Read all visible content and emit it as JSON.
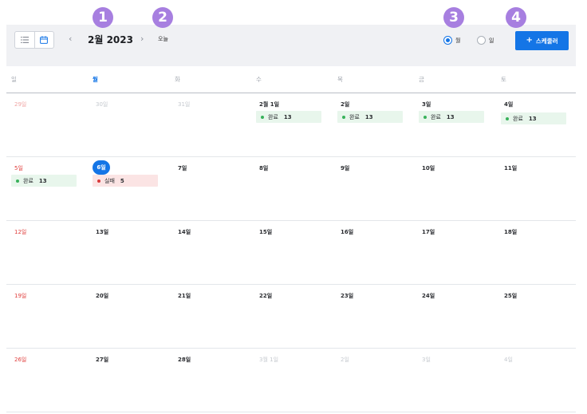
{
  "toolbar": {
    "month_title": "2월 2023",
    "prev_icon": "chevron-left-icon",
    "next_icon": "chevron-right-icon",
    "today_label": "오늘",
    "view_list_icon": "list-icon",
    "view_calendar_icon": "calendar-icon",
    "view_mode_month_label": "월",
    "view_mode_day_label": "일",
    "view_mode_selected": "월",
    "schedule_button_label": "스케줄러",
    "schedule_button_icon": "plus-icon",
    "accent_color": "#1475e6"
  },
  "callouts": [
    "1",
    "2",
    "3",
    "4"
  ],
  "weekdays": [
    "일",
    "월",
    "화",
    "수",
    "목",
    "금",
    "토"
  ],
  "weeks": [
    {
      "days": [
        {
          "label": "29일",
          "style": "muted-red"
        },
        {
          "label": "30일",
          "style": "muted"
        },
        {
          "label": "31일",
          "style": "muted"
        },
        {
          "label": "2월 1일",
          "style": "normal",
          "event": {
            "type": "done",
            "label": "완료",
            "count": "13"
          }
        },
        {
          "label": "2일",
          "style": "normal",
          "event": {
            "type": "done",
            "label": "완료",
            "count": "13"
          }
        },
        {
          "label": "3일",
          "style": "normal",
          "event": {
            "type": "done",
            "label": "완료",
            "count": "13"
          }
        },
        {
          "label": "4일",
          "style": "normal",
          "event": {
            "type": "done",
            "label": "완료",
            "count": "13"
          }
        }
      ]
    },
    {
      "days": [
        {
          "label": "5일",
          "style": "sun",
          "event": {
            "type": "done",
            "label": "완료",
            "count": "13"
          }
        },
        {
          "label": "6일",
          "style": "today",
          "event": {
            "type": "fail",
            "label": "실패",
            "count": "5"
          }
        },
        {
          "label": "7일",
          "style": "normal"
        },
        {
          "label": "8일",
          "style": "normal"
        },
        {
          "label": "9일",
          "style": "normal"
        },
        {
          "label": "10일",
          "style": "normal"
        },
        {
          "label": "11일",
          "style": "normal"
        }
      ]
    },
    {
      "days": [
        {
          "label": "12일",
          "style": "sun"
        },
        {
          "label": "13일",
          "style": "normal"
        },
        {
          "label": "14일",
          "style": "normal"
        },
        {
          "label": "15일",
          "style": "normal"
        },
        {
          "label": "16일",
          "style": "normal"
        },
        {
          "label": "17일",
          "style": "normal"
        },
        {
          "label": "18일",
          "style": "normal"
        }
      ]
    },
    {
      "days": [
        {
          "label": "19일",
          "style": "sun"
        },
        {
          "label": "20일",
          "style": "normal"
        },
        {
          "label": "21일",
          "style": "normal"
        },
        {
          "label": "22일",
          "style": "normal"
        },
        {
          "label": "23일",
          "style": "normal"
        },
        {
          "label": "24일",
          "style": "normal"
        },
        {
          "label": "25일",
          "style": "normal"
        }
      ]
    },
    {
      "days": [
        {
          "label": "26일",
          "style": "sun"
        },
        {
          "label": "27일",
          "style": "normal"
        },
        {
          "label": "28일",
          "style": "normal"
        },
        {
          "label": "3월 1일",
          "style": "muted"
        },
        {
          "label": "2일",
          "style": "muted"
        },
        {
          "label": "3일",
          "style": "muted"
        },
        {
          "label": "4일",
          "style": "muted"
        }
      ]
    }
  ]
}
